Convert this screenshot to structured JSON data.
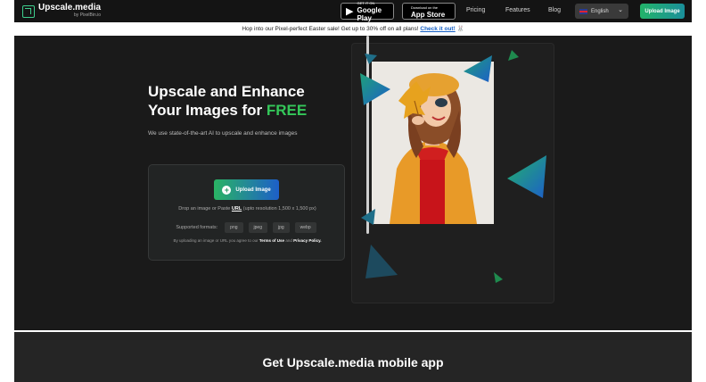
{
  "nav": {
    "brand": "Upscale.media",
    "brand_by": "by PixelBin.io",
    "google_play_small": "GET IT ON",
    "google_play_big": "Google Play",
    "app_store_small": "Download on the",
    "app_store_big": "App Store",
    "links": [
      "Pricing",
      "Features",
      "Blog"
    ],
    "language": "English",
    "upload_label": "Upload Image"
  },
  "promo": {
    "text": "Hop into our Pixel-perfect Easter sale! Get up to 30% off on all plans!",
    "link": "Check it out!",
    "emoji": "🐰"
  },
  "hero": {
    "title_line1": "Upscale and Enhance",
    "title_line2": "Your Images for ",
    "title_highlight": "FREE",
    "subtitle": "We use state-of-the-art AI to upscale and enhance images",
    "upload_button": "Upload Image",
    "drop_prefix": "Drop an image or Paste ",
    "drop_url": "URL",
    "drop_suffix": " (upto resolution 1,500 x 1,500 px)",
    "formats_label": "Supported formats:",
    "formats": [
      "png",
      "jpeg",
      "jpg",
      "webp"
    ],
    "terms_prefix": "By uploading an image or URL you agree to our ",
    "terms_link": "Terms of Use",
    "terms_mid": " and ",
    "privacy_link": "Privacy Policy."
  },
  "bottom": {
    "title": "Get Upscale.media mobile app"
  },
  "colors": {
    "accent_green": "#34c759",
    "gradient_start": "#2ab464",
    "gradient_end": "#1d5fc8",
    "link_blue": "#1560c6"
  }
}
